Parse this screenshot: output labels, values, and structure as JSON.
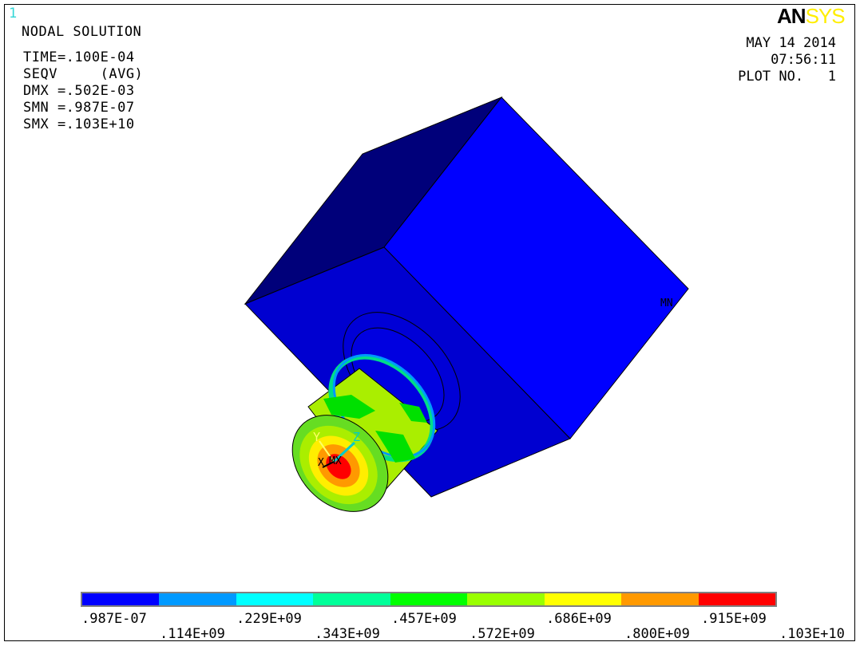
{
  "window_number": "1",
  "header": {
    "title": "NODAL SOLUTION",
    "lines": [
      "TIME=.100E-04",
      "SEQV     (AVG)",
      "DMX =.502E-03",
      "SMN =.987E-07",
      "SMX =.103E+10"
    ]
  },
  "logo": {
    "part1": "AN",
    "part2": "SYS"
  },
  "info": {
    "date": "MAY 14 2014",
    "time": "07:56:11",
    "plot": "PLOT NO.   1"
  },
  "model_labels": {
    "mn": "MN",
    "mx": "MX",
    "axis_x": "X",
    "axis_y": "Y",
    "axis_z": "Z"
  },
  "legend": {
    "colors": [
      "#0000ff",
      "#0099ff",
      "#00ffff",
      "#00ff99",
      "#00ff00",
      "#99ff00",
      "#ffff00",
      "#ff9900",
      "#ff0000"
    ],
    "labels_top": [
      ".987E-07",
      ".229E+09",
      ".457E+09",
      ".686E+09",
      ".915E+09"
    ],
    "labels_bottom": [
      ".114E+09",
      ".343E+09",
      ".572E+09",
      ".800E+09",
      ".103E+10"
    ]
  }
}
